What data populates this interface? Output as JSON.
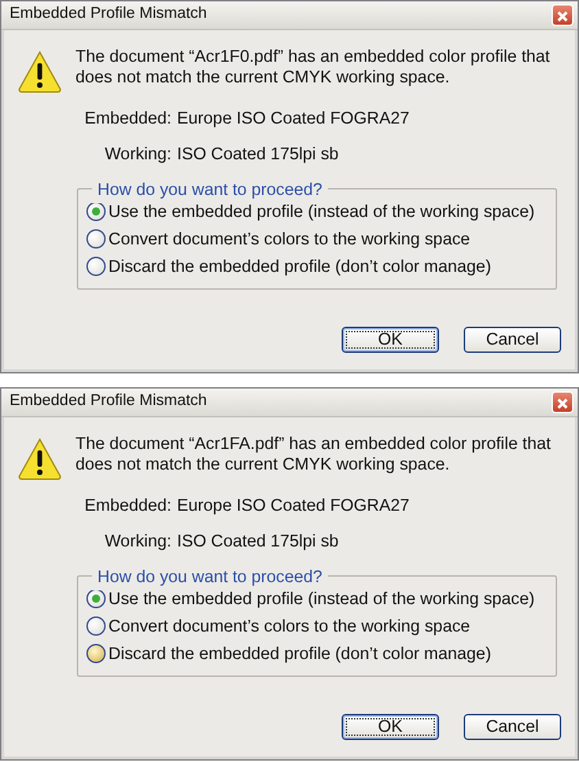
{
  "dialogs": [
    {
      "title": "Embedded Profile Mismatch",
      "message": "The document “Acr1F0.pdf” has an embedded color profile that does not match the current CMYK working space.",
      "rows": [
        {
          "label": "Embedded:",
          "value": "Europe ISO Coated FOGRA27"
        },
        {
          "label": "Working:",
          "value": "ISO Coated 175lpi sb"
        }
      ],
      "group": {
        "legend": "How do you want to proceed?",
        "options": [
          {
            "label": "Use the embedded profile (instead of the working space)",
            "selected": true,
            "hovered": false
          },
          {
            "label": "Convert document’s colors to the working space",
            "selected": false,
            "hovered": false
          },
          {
            "label": "Discard the embedded profile (don’t color manage)",
            "selected": false,
            "hovered": false
          }
        ]
      },
      "buttons": [
        {
          "label": "OK",
          "default": true
        },
        {
          "label": "Cancel",
          "default": false
        }
      ]
    },
    {
      "title": "Embedded Profile Mismatch",
      "message": "The document “Acr1FA.pdf” has an embedded color profile that does not match the current CMYK working space.",
      "rows": [
        {
          "label": "Embedded:",
          "value": "Europe ISO Coated FOGRA27"
        },
        {
          "label": "Working:",
          "value": "ISO Coated 175lpi sb"
        }
      ],
      "group": {
        "legend": "How do you want to proceed?",
        "options": [
          {
            "label": "Use the embedded profile (instead of the working space)",
            "selected": true,
            "hovered": false
          },
          {
            "label": "Convert document’s colors to the working space",
            "selected": false,
            "hovered": false
          },
          {
            "label": "Discard the embedded profile (don’t color manage)",
            "selected": false,
            "hovered": true
          }
        ]
      },
      "buttons": [
        {
          "label": "OK",
          "default": true
        },
        {
          "label": "Cancel",
          "default": false
        }
      ]
    }
  ]
}
